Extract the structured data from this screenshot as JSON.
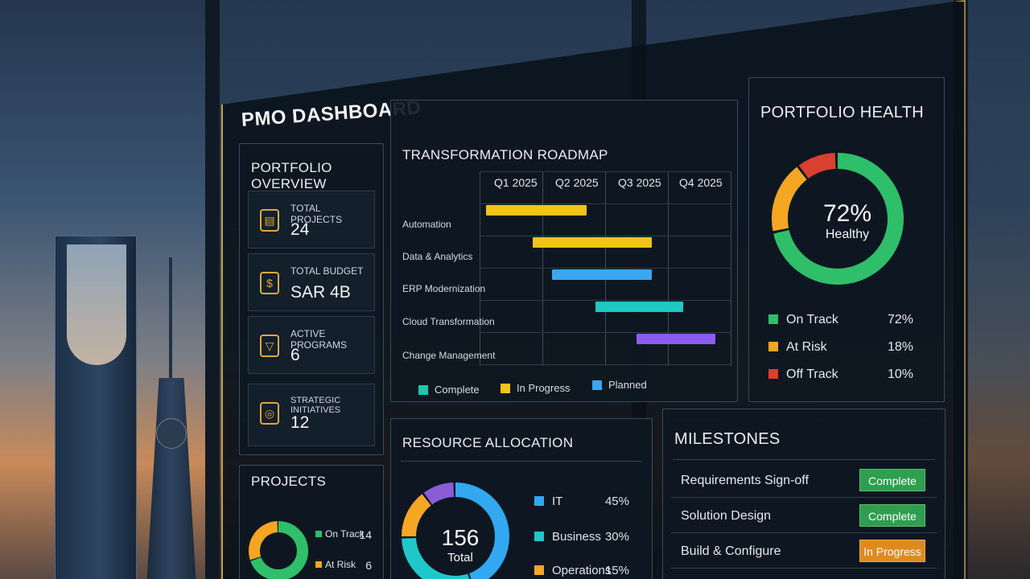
{
  "title": "PMO DASHBOARD",
  "overview": {
    "heading": "PORTFOLIO OVERVIEW",
    "items": [
      {
        "label": "TOTAL PROJECTS",
        "value": "24",
        "icon": "clipboard-icon"
      },
      {
        "label": "TOTAL BUDGET",
        "value": "SAR 4B",
        "icon": "money-bag-icon"
      },
      {
        "label": "ACTIVE PROGRAMS",
        "value": "6",
        "icon": "funnel-icon"
      },
      {
        "label": "STRATEGIC INITIATIVES",
        "value": "12",
        "icon": "target-icon"
      }
    ]
  },
  "roadmap": {
    "heading": "TRANSFORMATION ROADMAP",
    "quarters": [
      "Q1 2025",
      "Q2 2025",
      "Q3 2025",
      "Q4 2025"
    ],
    "rows": [
      {
        "label": "Automation",
        "start": 0.1,
        "end": 1.7,
        "status": "In Progress"
      },
      {
        "label": "Data & Analytics",
        "start": 0.85,
        "end": 2.75,
        "status": "In Progress"
      },
      {
        "label": "ERP Modernization",
        "start": 1.15,
        "end": 2.75,
        "status": "Planned"
      },
      {
        "label": "Cloud Transformation",
        "start": 1.85,
        "end": 3.25,
        "status": "Complete"
      },
      {
        "label": "Change Management",
        "start": 2.5,
        "end": 3.75,
        "status": "Other"
      }
    ],
    "legend": [
      {
        "label": "Complete",
        "color": "#1fc8a8"
      },
      {
        "label": "In Progress",
        "color": "#f2c417"
      },
      {
        "label": "Planned",
        "color": "#3aa7f0"
      }
    ],
    "colors": {
      "Complete": "#1ec9c4",
      "In Progress": "#f2c417",
      "Planned": "#3aa7f0",
      "Other": "#8a5cf0"
    }
  },
  "health": {
    "heading": "PORTFOLIO HEALTH",
    "center_value": "72%",
    "center_label": "Healthy",
    "rows": [
      {
        "label": "On Track",
        "value": "72%",
        "pct": 72,
        "color": "#2fbf6a"
      },
      {
        "label": "At Risk",
        "value": "18%",
        "pct": 18,
        "color": "#f5a623"
      },
      {
        "label": "Off Track",
        "value": "10%",
        "pct": 10,
        "color": "#d8402f"
      }
    ]
  },
  "projects": {
    "heading": "PROJECTS",
    "rows": [
      {
        "label": "On Track",
        "value": "14",
        "count": 14,
        "color": "#2fbf6a"
      },
      {
        "label": "At Risk",
        "value": "6",
        "count": 6,
        "color": "#f5a623"
      }
    ]
  },
  "resources": {
    "heading": "RESOURCE ALLOCATION",
    "center_value": "156",
    "center_label": "Total",
    "rows": [
      {
        "label": "IT",
        "value": "45%",
        "pct": 45,
        "color": "#31a8f0"
      },
      {
        "label": "Business",
        "value": "30%",
        "pct": 30,
        "color": "#1fc8c8"
      },
      {
        "label": "Operations",
        "value": "15%",
        "pct": 15,
        "color": "#f5a623"
      }
    ],
    "extra_segment_color": "#8a5cd6"
  },
  "milestones": {
    "heading": "MILESTONES",
    "rows": [
      {
        "name": "Requirements Sign-off",
        "status": "Complete",
        "color": "#2e9e4f"
      },
      {
        "name": "Solution Design",
        "status": "Complete",
        "color": "#2e9e4f"
      },
      {
        "name": "Build & Configure",
        "status": "In Progress",
        "color": "#e08a1e"
      }
    ]
  }
}
